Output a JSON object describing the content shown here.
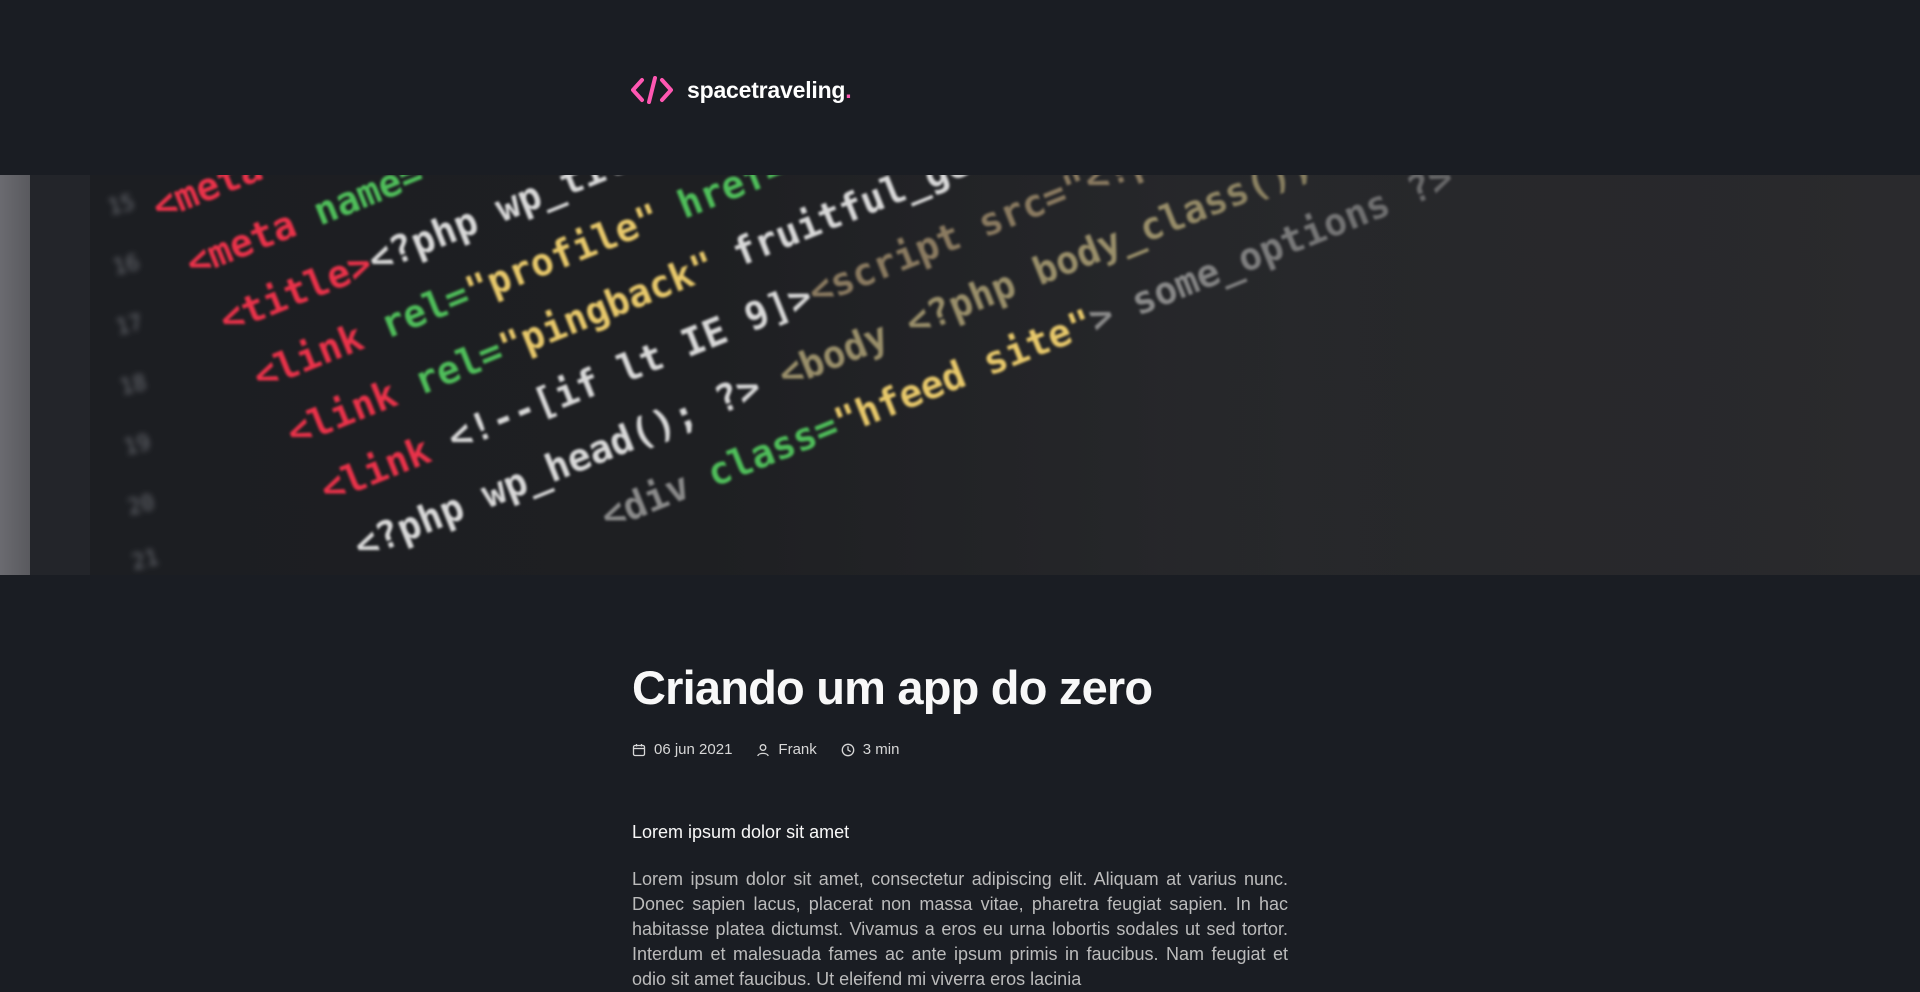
{
  "header": {
    "logo_name": "spacetraveling",
    "logo_dot": ".",
    "logo_icon": "code-brackets-icon",
    "accent_color": "#ff57b2"
  },
  "banner": {
    "image": "code-on-screen-image"
  },
  "post": {
    "title": "Criando um app do zero",
    "date": "06 jun 2021",
    "author": "Frank",
    "reading_time": "3 min",
    "icons": [
      "calendar-icon",
      "user-icon",
      "clock-icon"
    ],
    "sections": [
      {
        "heading": "Lorem ipsum dolor sit amet",
        "body": "Lorem ipsum dolor sit amet, consectetur adipiscing elit. Aliquam at varius nunc. Donec sapien lacus, placerat non massa vitae, pharetra feugiat sapien. In hac habitasse platea dictumst. Vivamus a eros eu urna lobortis sodales ut sed tortor. Interdum et malesuada fames ac ante ipsum primis in faucibus. Nam feugiat et odio sit amet faucibus. Ut eleifend mi viverra eros lacinia"
      }
    ]
  }
}
